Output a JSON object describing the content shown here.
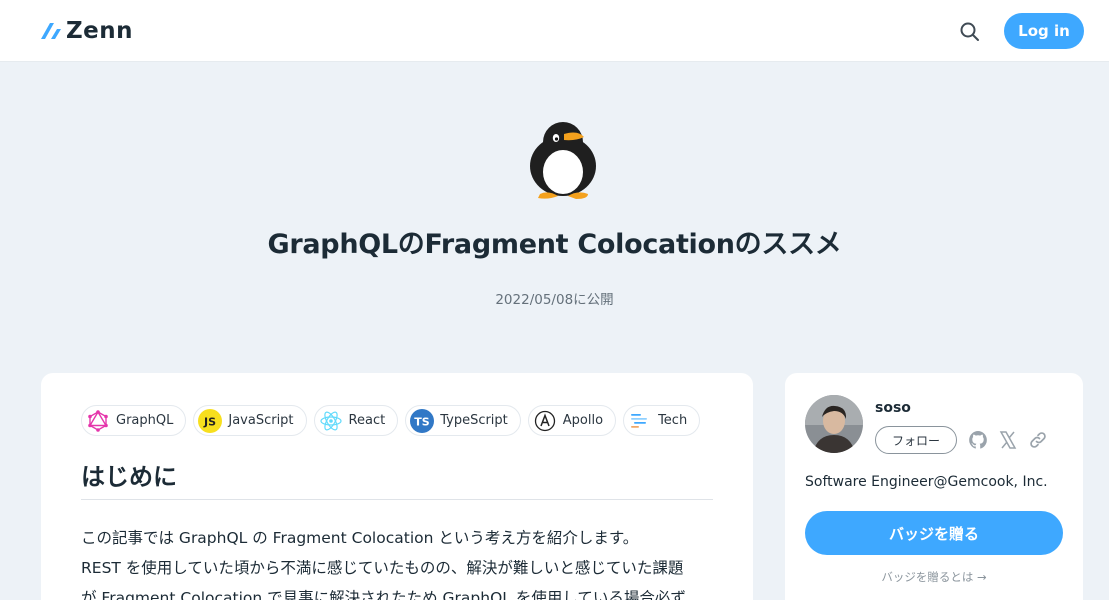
{
  "header": {
    "logo_text": "Zenn",
    "login_label": "Log in"
  },
  "article": {
    "emoji": "penguin",
    "title": "GraphQLのFragment Colocationのススメ",
    "published": "2022/05/08に公開",
    "topics": [
      {
        "label": "GraphQL",
        "icon": "graphql-icon"
      },
      {
        "label": "JavaScript",
        "icon": "javascript-icon"
      },
      {
        "label": "React",
        "icon": "react-icon"
      },
      {
        "label": "TypeScript",
        "icon": "typescript-icon"
      },
      {
        "label": "Apollo",
        "icon": "apollo-icon"
      },
      {
        "label": "Tech",
        "icon": "tech-icon"
      }
    ],
    "heading": "はじめに",
    "paragraph_lines": [
      "この記事では GraphQL の Fragment Colocation という考え方を紹介します。",
      "REST を使用していた頃から不満に感じていたものの、解決が難しいと感じていた課題",
      "が Fragment Colocation で見事に解決されたため GraphQL を使用している場合必ず"
    ]
  },
  "author": {
    "name": "soso",
    "follow_label": "フォロー",
    "bio": "Software Engineer@Gemcook, Inc.",
    "badge_button": "バッジを贈る",
    "badge_link": "バッジを贈るとは →"
  },
  "colors": {
    "accent": "#3ea8ff",
    "background": "#edf2f7",
    "text": "#1c2b36"
  }
}
